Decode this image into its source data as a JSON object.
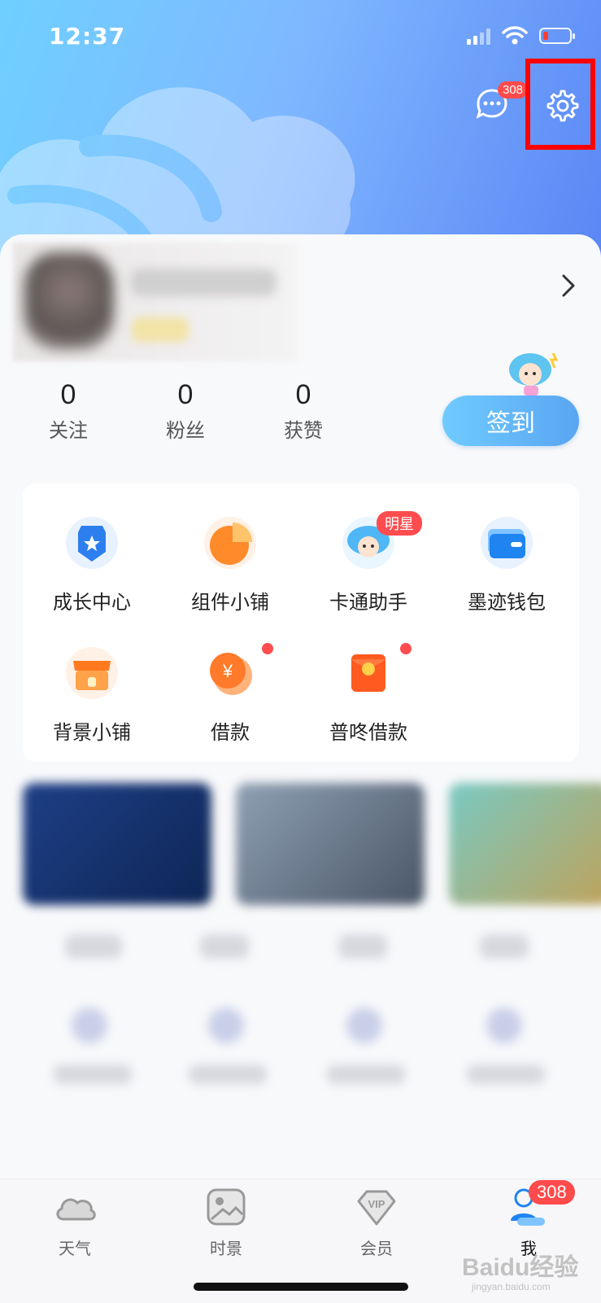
{
  "status_bar": {
    "time": "12:37"
  },
  "header": {
    "message_badge": "308"
  },
  "profile": {
    "stats": [
      {
        "value": "0",
        "label": "关注"
      },
      {
        "value": "0",
        "label": "粉丝"
      },
      {
        "value": "0",
        "label": "获赞"
      }
    ],
    "signin_label": "签到"
  },
  "tools": [
    {
      "label": "成长中心",
      "icon": "medal-icon"
    },
    {
      "label": "组件小铺",
      "icon": "pie-chart-icon"
    },
    {
      "label": "卡通助手",
      "icon": "cartoon-cloud-icon",
      "badge": "明星"
    },
    {
      "label": "墨迹钱包",
      "icon": "wallet-icon"
    },
    {
      "label": "背景小铺",
      "icon": "shop-icon"
    },
    {
      "label": "借款",
      "icon": "coin-icon"
    },
    {
      "label": "普咚借款",
      "icon": "red-envelope-icon"
    }
  ],
  "tabbar": {
    "items": [
      {
        "label": "天气",
        "icon": "cloud-icon"
      },
      {
        "label": "时景",
        "icon": "picture-icon"
      },
      {
        "label": "会员",
        "icon": "vip-diamond-icon"
      },
      {
        "label": "我",
        "icon": "user-icon"
      }
    ],
    "badge": "308"
  },
  "watermark": {
    "text": "Baidu经验",
    "sub": "jingyan.baidu.com"
  },
  "colors": {
    "accent": "#5aa5f2",
    "badge": "#ff4b4b",
    "highlight": "#ff0000"
  }
}
